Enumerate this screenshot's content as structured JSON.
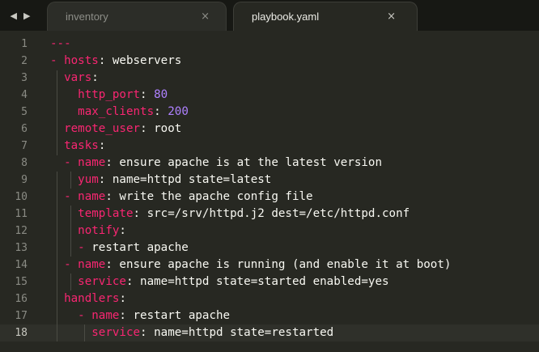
{
  "nav": {
    "back_glyph": "◀",
    "forward_glyph": "▶"
  },
  "tabs": [
    {
      "label": "inventory",
      "close": "×",
      "active": false
    },
    {
      "label": "playbook.yaml",
      "close": "×",
      "active": true
    }
  ],
  "colors": {
    "background": "#272822",
    "key": "#f92672",
    "text": "#f8f8f2",
    "number": "#ae81ff",
    "comment": "#75715e"
  },
  "editor": {
    "current_line": 18,
    "line_numbers": [
      "1",
      "2",
      "3",
      "4",
      "5",
      "6",
      "7",
      "8",
      "9",
      "10",
      "11",
      "12",
      "13",
      "14",
      "15",
      "16",
      "17",
      "18"
    ],
    "lines": [
      [
        {
          "t": "---",
          "c": "k"
        }
      ],
      [
        {
          "t": "- ",
          "c": "k"
        },
        {
          "t": "hosts",
          "c": "k"
        },
        {
          "t": ": webservers",
          "c": "p"
        }
      ],
      [
        {
          "t": "  ",
          "c": "p"
        },
        {
          "t": "vars",
          "c": "k"
        },
        {
          "t": ":",
          "c": "p"
        }
      ],
      [
        {
          "t": "    ",
          "c": "p"
        },
        {
          "t": "http_port",
          "c": "k"
        },
        {
          "t": ": ",
          "c": "p"
        },
        {
          "t": "80",
          "c": "n"
        }
      ],
      [
        {
          "t": "    ",
          "c": "p"
        },
        {
          "t": "max_clients",
          "c": "k"
        },
        {
          "t": ": ",
          "c": "p"
        },
        {
          "t": "200",
          "c": "n"
        }
      ],
      [
        {
          "t": "  ",
          "c": "p"
        },
        {
          "t": "remote_user",
          "c": "k"
        },
        {
          "t": ": root",
          "c": "p"
        }
      ],
      [
        {
          "t": "  ",
          "c": "p"
        },
        {
          "t": "tasks",
          "c": "k"
        },
        {
          "t": ":",
          "c": "p"
        }
      ],
      [
        {
          "t": "  - ",
          "c": "k"
        },
        {
          "t": "name",
          "c": "k"
        },
        {
          "t": ": ensure apache is at the latest version",
          "c": "p"
        }
      ],
      [
        {
          "t": "    ",
          "c": "p"
        },
        {
          "t": "yum",
          "c": "k"
        },
        {
          "t": ": name=httpd state=latest",
          "c": "p"
        }
      ],
      [
        {
          "t": "  - ",
          "c": "k"
        },
        {
          "t": "name",
          "c": "k"
        },
        {
          "t": ": write the apache config file",
          "c": "p"
        }
      ],
      [
        {
          "t": "    ",
          "c": "p"
        },
        {
          "t": "template",
          "c": "k"
        },
        {
          "t": ": src=/srv/httpd.j2 dest=/etc/httpd.conf",
          "c": "p"
        }
      ],
      [
        {
          "t": "    ",
          "c": "p"
        },
        {
          "t": "notify",
          "c": "k"
        },
        {
          "t": ":",
          "c": "p"
        }
      ],
      [
        {
          "t": "    - ",
          "c": "k"
        },
        {
          "t": "restart apache",
          "c": "p"
        }
      ],
      [
        {
          "t": "  - ",
          "c": "k"
        },
        {
          "t": "name",
          "c": "k"
        },
        {
          "t": ": ensure apache is running (and enable it at boot)",
          "c": "p"
        }
      ],
      [
        {
          "t": "    ",
          "c": "p"
        },
        {
          "t": "service",
          "c": "k"
        },
        {
          "t": ": name=httpd state=started enabled=yes",
          "c": "p"
        }
      ],
      [
        {
          "t": "  ",
          "c": "p"
        },
        {
          "t": "handlers",
          "c": "k"
        },
        {
          "t": ":",
          "c": "p"
        }
      ],
      [
        {
          "t": "    - ",
          "c": "k"
        },
        {
          "t": "name",
          "c": "k"
        },
        {
          "t": ": restart apache",
          "c": "p"
        }
      ],
      [
        {
          "t": "      ",
          "c": "p"
        },
        {
          "t": "service",
          "c": "k"
        },
        {
          "t": ": name=httpd state=restarted",
          "c": "p"
        }
      ]
    ]
  }
}
